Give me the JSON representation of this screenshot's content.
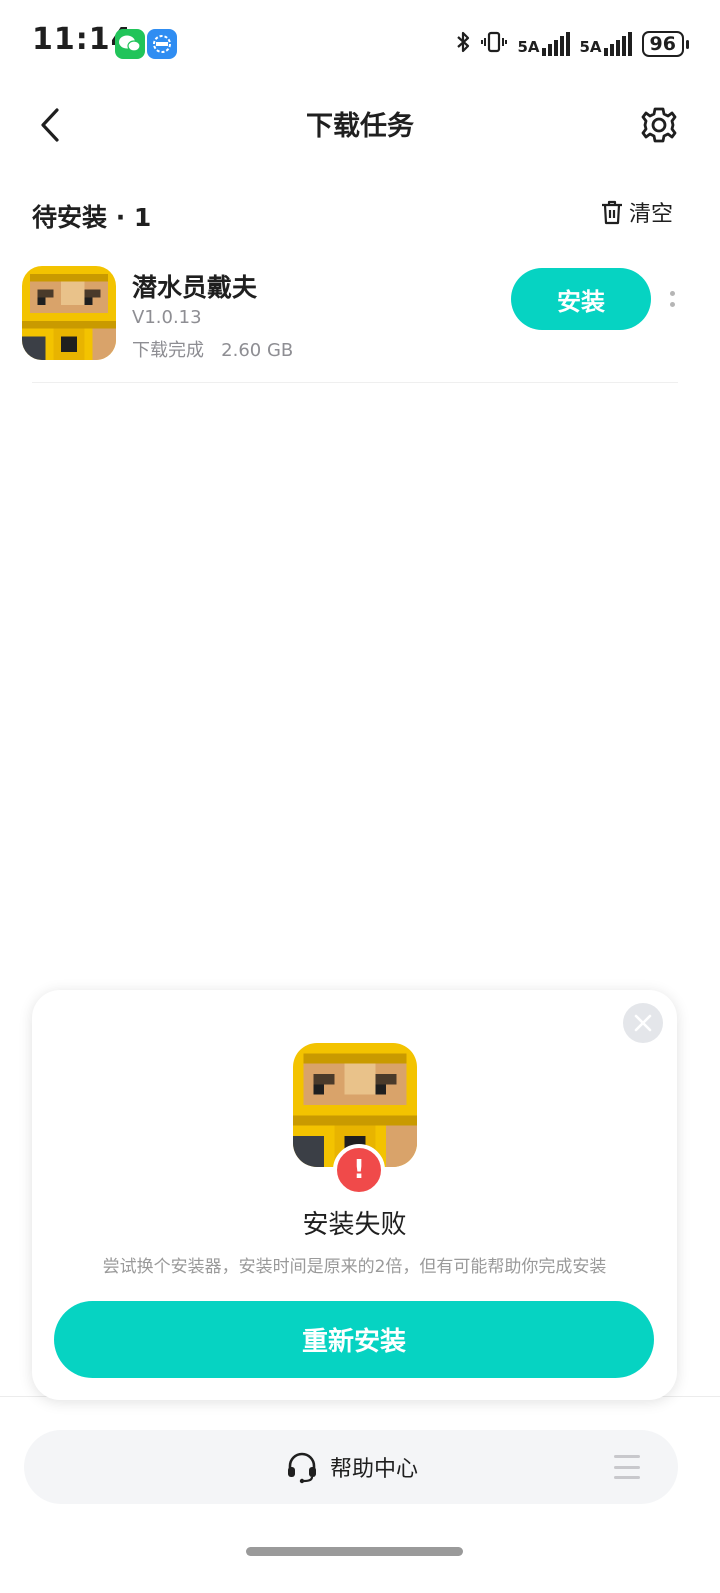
{
  "status_bar": {
    "time": "11:14",
    "network_1": "5A",
    "network_2": "5A",
    "battery": "96"
  },
  "header": {
    "title": "下载任务",
    "back_icon": "chevron-left-icon",
    "settings_icon": "gear-icon"
  },
  "section": {
    "title": "待安装 · 1",
    "clear_label": "清空"
  },
  "task": {
    "name": "潜水员戴夫",
    "version": "V1.0.13",
    "status": "下载完成",
    "size": "2.60 GB",
    "install_label": "安装"
  },
  "dialog": {
    "title": "安装失败",
    "description": "尝试换个安装器，安装时间是原来的2倍，但有可能帮助你完成安装",
    "button_label": "重新安装",
    "error_mark": "!"
  },
  "help": {
    "label": "帮助中心"
  },
  "colors": {
    "accent": "#06d3c2",
    "error": "#f04a4a"
  }
}
